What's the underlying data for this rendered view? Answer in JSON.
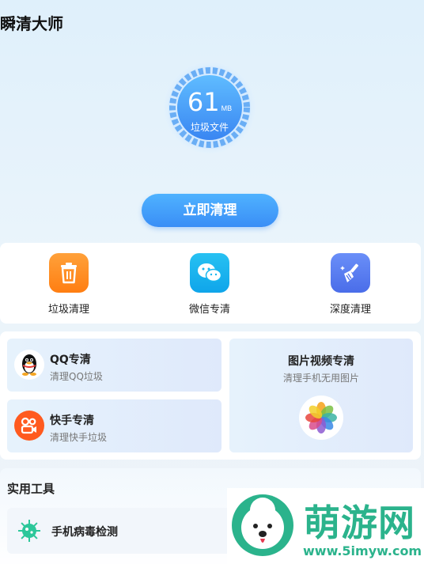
{
  "app": {
    "title": "瞬清大师"
  },
  "gauge": {
    "value": "61",
    "unit": "MB",
    "label": "垃圾文件",
    "accent": "#3a8ef6"
  },
  "actions": {
    "clean_now": "立即清理"
  },
  "quick_tools": [
    {
      "label": "垃圾清理",
      "icon": "trash-icon",
      "color": "#ff8a1f"
    },
    {
      "label": "微信专清",
      "icon": "wechat-icon",
      "color": "#17b6ef"
    },
    {
      "label": "深度清理",
      "icon": "broom-icon",
      "color": "#4d7cf5"
    }
  ],
  "special": {
    "qq": {
      "title": "QQ专清",
      "desc": "清理QQ垃圾",
      "icon": "qq-penguin-icon"
    },
    "kuaishou": {
      "title": "快手专清",
      "desc": "清理快手垃圾",
      "icon": "kuaishou-icon"
    },
    "media": {
      "title": "图片视频专清",
      "desc": "清理手机无用图片",
      "icon": "photos-flower-icon"
    }
  },
  "tools": {
    "title": "实用工具",
    "items": [
      {
        "label": "手机病毒检测",
        "icon": "virus-icon"
      }
    ]
  },
  "watermark": {
    "text": "萌游网",
    "url": "www.5imyw.com"
  }
}
